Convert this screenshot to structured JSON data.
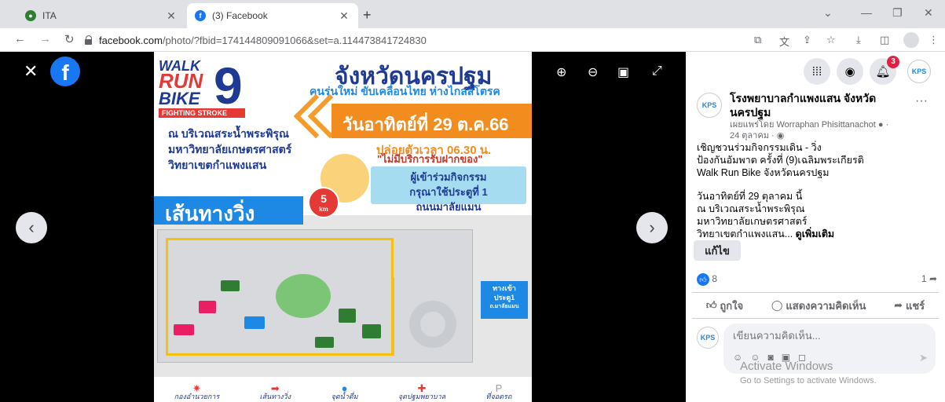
{
  "browser": {
    "tabs": [
      {
        "title": "ITA",
        "active": false
      },
      {
        "title": "(3) Facebook",
        "active": true
      }
    ],
    "url_host": "facebook.com",
    "url_path": "/photo/?fbid=174144809091066&set=a.114473841724830"
  },
  "poster": {
    "logo_walk": "WALK",
    "logo_run": "RUN",
    "logo_bike": "BIKE",
    "logo_number": "9",
    "logo_tag": "FIGHTING STROKE",
    "province": "จังหวัดนครปฐม",
    "slogan": "คนรุ่นใหม่ ขับเคลื่อนไทย ห่างไกลสโตรค",
    "date": "วันอาทิตย์ที่ 29 ต.ค.66",
    "start_time": "ปล่อยตัวเวลา 06.30 น.",
    "venue_line1": "ณ บริเวณสระน้ำพระพิรุณ",
    "venue_line2": "มหาวิทยาลัยเกษตรศาสตร์",
    "venue_line3": "วิทยาเขตกำแพงแสน",
    "no_bag": "\"ไม่มีบริการรับฝากของ\"",
    "entry_line1": "ผู้เข้าร่วมกิจกรรม",
    "entry_line2": "กรุณาใช้ประตูที่ 1",
    "entry_line3": "ถนนมาลัยแมน",
    "route_title": "เส้นทางวิ่ง",
    "distance_value": "5",
    "distance_unit": "km",
    "gate_line1": "ทางเข้า",
    "gate_line2": "ประตู1",
    "gate_line3": "ถ.มาลัยแมน",
    "legend": [
      {
        "label": "กองอำนวยการ",
        "icon": "✷",
        "color": "#e53935"
      },
      {
        "label": "เส้นทางวิ่ง",
        "icon": "➡",
        "color": "#e53935"
      },
      {
        "label": "จุดน้ำดื่ม",
        "icon": "●",
        "color": "#1e88e5"
      },
      {
        "label": "จุดปฐมพยาบาล",
        "icon": "✚",
        "color": "#e53935"
      },
      {
        "label": "ที่จอดรถ",
        "icon": "P",
        "color": "#9e9e9e"
      }
    ]
  },
  "panel": {
    "notification_count": "3",
    "page_name_line1": "โรงพยาบาลกำแพงแสน จังหวัด",
    "page_name_line2": "นครปฐม",
    "published_by": "เผยแพร่โดย Worraphan Phisittanachot",
    "date": "24 ตุลาคม",
    "body_line1": "เชิญชวนร่วมกิจกรรมเดิน - วิ่ง",
    "body_line2": "ป้องกันอัมพาต ครั้งที่ (9)เฉลิมพระเกียรติ",
    "body_line3": "Walk Run Bike จังหวัดนครปฐม",
    "body_line4": "วันอาทิตย์ที่ 29 ตุลาคม นี้",
    "body_line5": "ณ บริเวณสระน้ำพระพิรุณ",
    "body_line6": "มหาวิทยาลัยเกษตรศาสตร์",
    "body_line7": "วิทยาเขตกำแพงแสน...",
    "see_more": "ดูเพิ่มเติม",
    "edit_label": "แก้ไข",
    "likes": "8",
    "shares": "1",
    "like_label": "ถูกใจ",
    "comment_label": "แสดงความคิดเห็น",
    "share_label": "แชร์",
    "comment_placeholder": "เขียนความคิดเห็น..."
  },
  "watermark": {
    "line1": "Activate Windows",
    "line2": "Go to Settings to activate Windows."
  }
}
